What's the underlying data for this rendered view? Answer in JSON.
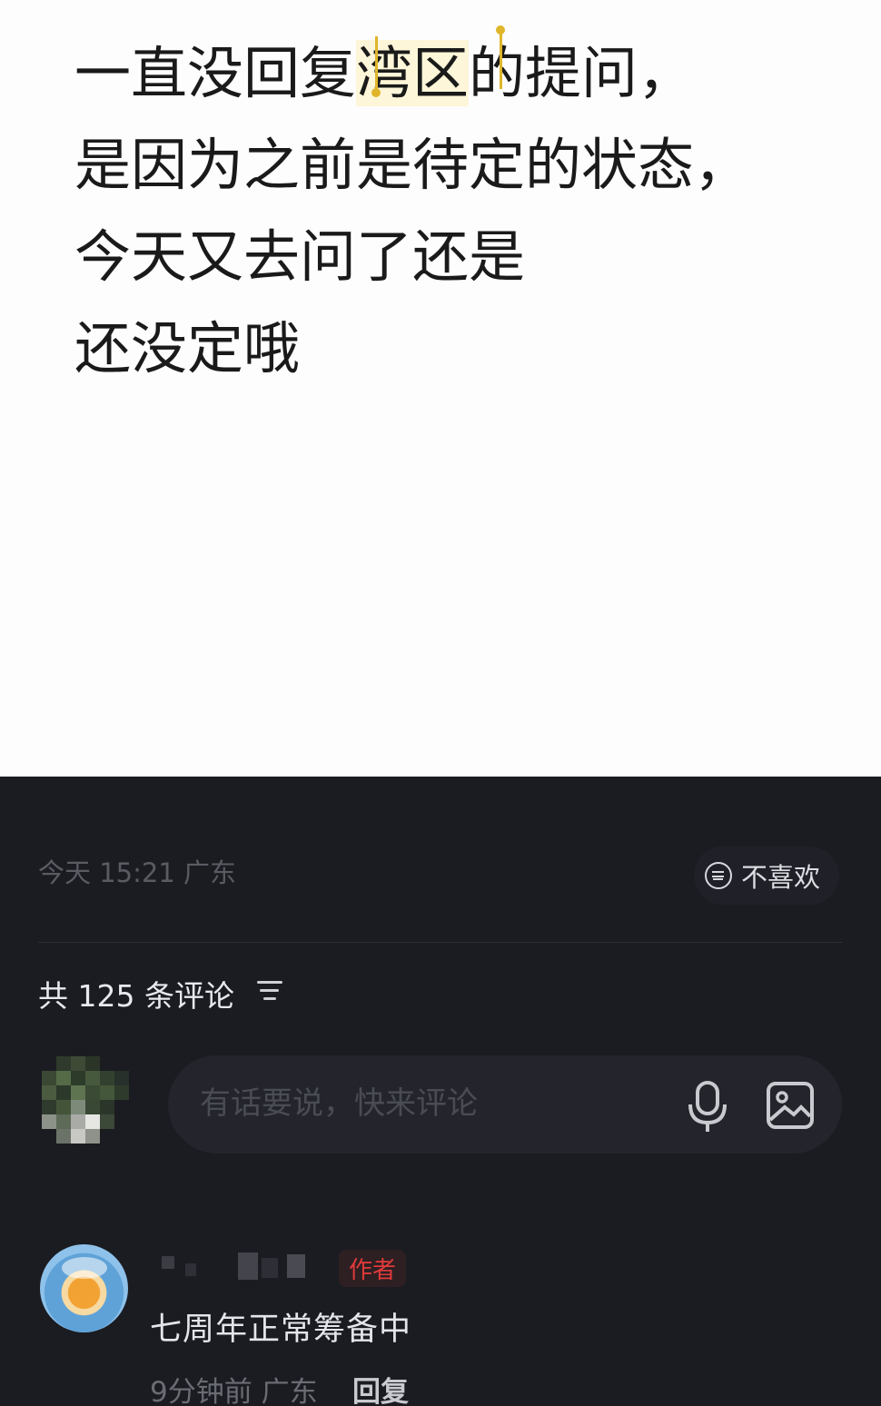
{
  "post": {
    "lines": [
      {
        "before": "一直没回复",
        "highlight": "湾区",
        "after": "的提问，"
      },
      {
        "text": "是因为之前是待定的状态，"
      },
      {
        "text": "今天又去问了还是"
      },
      {
        "text": "还没定哦"
      }
    ]
  },
  "post_meta": {
    "time_location": "今天 15:21 广东",
    "dislike_label": "不喜欢",
    "dislike_icon": "neutral-face-icon"
  },
  "comments": {
    "count_text": "共 125 条评论",
    "sort_icon": "sort-icon",
    "input": {
      "placeholder": "有话要说，快来评论",
      "voice_icon": "microphone-icon",
      "image_icon": "image-icon"
    },
    "items": [
      {
        "badge": "作者",
        "text": "七周年正常筹备中",
        "time_location": "9分钟前 广东",
        "reply_label": "回复"
      }
    ]
  },
  "colors": {
    "post_background": "#fdfdfd",
    "comments_background": "#1b1c22",
    "selection_handle": "#e0b52a",
    "author_badge": "#e03a3a"
  }
}
